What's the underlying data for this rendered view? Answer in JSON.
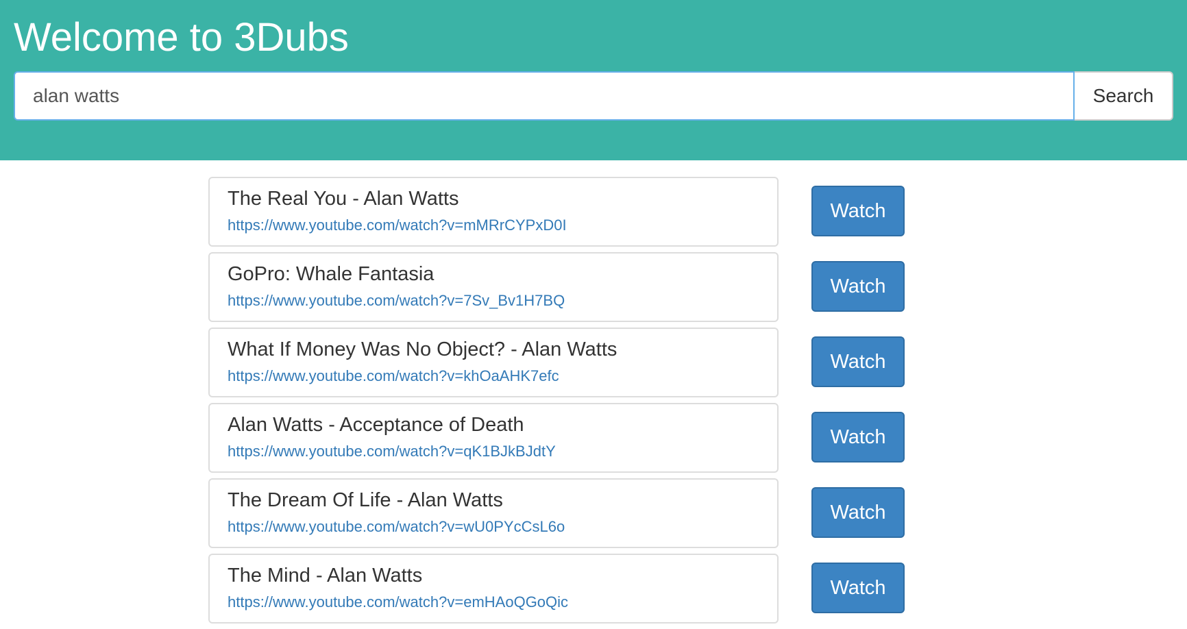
{
  "header": {
    "title": "Welcome to 3Dubs",
    "background_color": "#3bb3a6"
  },
  "search": {
    "value": "alan watts",
    "button_label": "Search"
  },
  "results": [
    {
      "title": "The Real You - Alan Watts",
      "url": "https://www.youtube.com/watch?v=mMRrCYPxD0I",
      "button_label": "Watch"
    },
    {
      "title": "GoPro: Whale Fantasia",
      "url": "https://www.youtube.com/watch?v=7Sv_Bv1H7BQ",
      "button_label": "Watch"
    },
    {
      "title": "What If Money Was No Object? - Alan Watts",
      "url": "https://www.youtube.com/watch?v=khOaAHK7efc",
      "button_label": "Watch"
    },
    {
      "title": "Alan Watts - Acceptance of Death",
      "url": "https://www.youtube.com/watch?v=qK1BJkBJdtY",
      "button_label": "Watch"
    },
    {
      "title": "The Dream Of Life - Alan Watts",
      "url": "https://www.youtube.com/watch?v=wU0PYcCsL6o",
      "button_label": "Watch"
    },
    {
      "title": "The Mind - Alan Watts",
      "url": "https://www.youtube.com/watch?v=emHAoQGoQic",
      "button_label": "Watch"
    }
  ],
  "colors": {
    "accent": "#3bb3a6",
    "primary_button": "#3c84c3",
    "link": "#337ab7"
  }
}
